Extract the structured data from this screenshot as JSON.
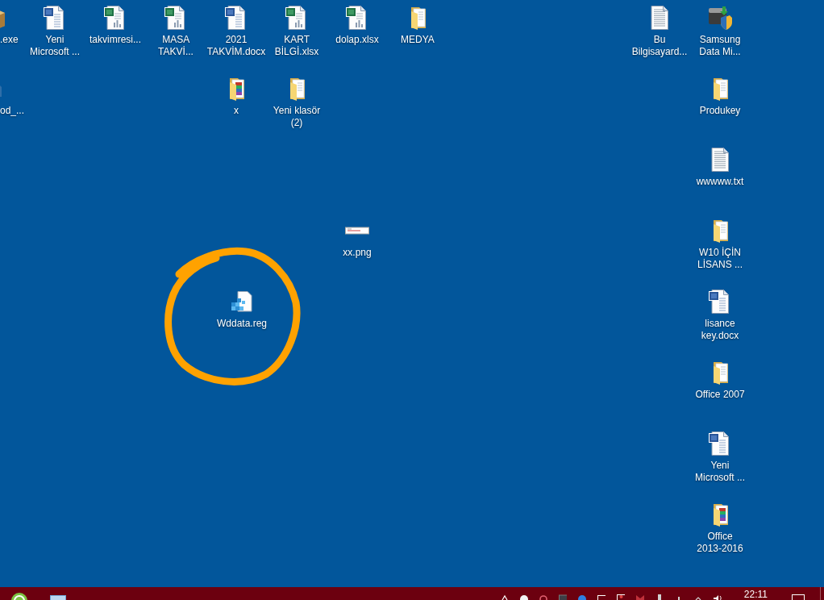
{
  "desktop": {
    "icons": [
      {
        "label": ".exe",
        "kind": "installer"
      },
      {
        "label": "Yeni Microsoft ...",
        "kind": "word"
      },
      {
        "label": "takvimresi...",
        "kind": "excel"
      },
      {
        "label": "MASA TAKVİ...",
        "kind": "excel"
      },
      {
        "label": "2021 TAKVİM.docx",
        "kind": "word"
      },
      {
        "label": "KART BİLGİ.xlsx",
        "kind": "excel"
      },
      {
        "label": "dolap.xlsx",
        "kind": "excel"
      },
      {
        "label": "MEDYA",
        "kind": "folder"
      },
      {
        "label": "Bu Bilgisayard...",
        "kind": "text"
      },
      {
        "label": "Samsung Data Mi...",
        "kind": "app"
      },
      {
        "label": "od_...",
        "kind": "generic"
      },
      {
        "label": "x",
        "kind": "archive"
      },
      {
        "label": "Yeni klasör (2)",
        "kind": "folder"
      },
      {
        "label": "Produkey",
        "kind": "folder"
      },
      {
        "label": "wwwww.txt",
        "kind": "text"
      },
      {
        "label": "xx.png",
        "kind": "image"
      },
      {
        "label": "W10 İÇİN LİSANS ...",
        "kind": "folder"
      },
      {
        "label": "Wddata.reg",
        "kind": "registry"
      },
      {
        "label": "lisance key.docx",
        "kind": "word"
      },
      {
        "label": "Office 2007",
        "kind": "folder"
      },
      {
        "label": "Yeni Microsoft ...",
        "kind": "word"
      },
      {
        "label": "Office 2013-2016",
        "kind": "archive"
      }
    ]
  },
  "taskbar": {
    "clock": "22:11"
  }
}
